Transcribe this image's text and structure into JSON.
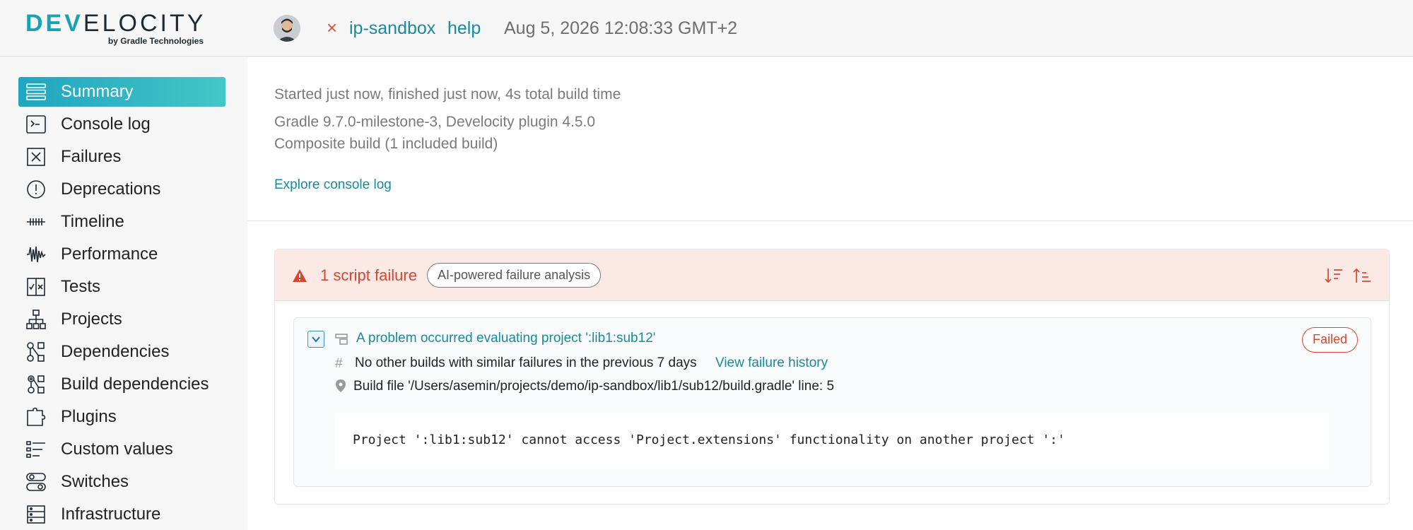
{
  "header": {
    "logo_text": "DEVELOCITY",
    "logo_subtext": "by Gradle Technologies",
    "status_glyph": "×",
    "project": "ip-sandbox",
    "task": "help",
    "datetime": "Aug 5, 2026 12:08:33 GMT+2"
  },
  "sidebar": {
    "items": [
      {
        "label": "Summary",
        "icon": "summary-icon",
        "active": true
      },
      {
        "label": "Console log",
        "icon": "console-icon"
      },
      {
        "label": "Failures",
        "icon": "failures-icon"
      },
      {
        "label": "Deprecations",
        "icon": "deprecations-icon"
      },
      {
        "label": "Timeline",
        "icon": "timeline-icon"
      },
      {
        "label": "Performance",
        "icon": "performance-icon"
      },
      {
        "label": "Tests",
        "icon": "tests-icon"
      },
      {
        "label": "Projects",
        "icon": "projects-icon"
      },
      {
        "label": "Dependencies",
        "icon": "dependencies-icon"
      },
      {
        "label": "Build dependencies",
        "icon": "build-dependencies-icon"
      },
      {
        "label": "Plugins",
        "icon": "plugins-icon"
      },
      {
        "label": "Custom values",
        "icon": "custom-values-icon"
      },
      {
        "label": "Switches",
        "icon": "switches-icon"
      },
      {
        "label": "Infrastructure",
        "icon": "infrastructure-icon"
      }
    ]
  },
  "summary": {
    "timing": "Started just now, finished just now, 4s total build time",
    "versions": "Gradle 9.7.0-milestone-3, Develocity plugin 4.5.0",
    "composite": "Composite build (1 included build)",
    "console_link": "Explore console log"
  },
  "failures": {
    "count_label": "1 script failure",
    "ai_label": "AI-powered failure analysis",
    "accent": "#d4462f",
    "item": {
      "title": "A problem occurred evaluating project ':lib1:sub12'",
      "status": "Failed",
      "hash_glyph": "#",
      "similar": "No other builds with similar failures in the previous 7 days",
      "history_link": "View failure history",
      "location": "Build file '/Users/asemin/projects/demo/ip-sandbox/lib1/sub12/build.gradle' line: 5",
      "message": "Project ':lib1:sub12' cannot access 'Project.extensions' functionality on another project ':'"
    }
  },
  "colors": {
    "link": "#178a9b",
    "active_nav_start": "#1fa5c1",
    "active_nav_end": "#45c6c6",
    "failure_bg": "#fbe9e6"
  }
}
